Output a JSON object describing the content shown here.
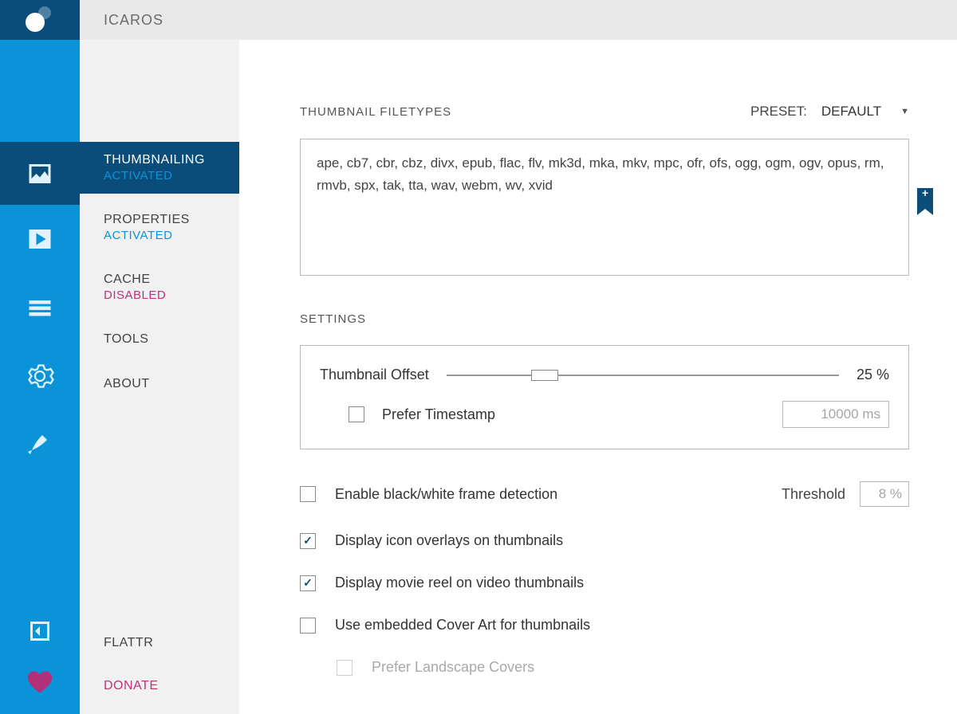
{
  "header": {
    "title": "ICAROS"
  },
  "sidebar": {
    "items": [
      {
        "label": "THUMBNAILING",
        "status": "ACTIVATED",
        "status_class": "activated"
      },
      {
        "label": "PROPERTIES",
        "status": "ACTIVATED",
        "status_class": "activated"
      },
      {
        "label": "CACHE",
        "status": "DISABLED",
        "status_class": "disabled"
      },
      {
        "label": "TOOLS"
      },
      {
        "label": "ABOUT"
      }
    ],
    "bottom": {
      "flattr": "FLATTR",
      "donate": "DONATE"
    }
  },
  "main": {
    "filetypes": {
      "title": "THUMBNAIL FILETYPES",
      "preset_label": "PRESET:",
      "preset_value": "DEFAULT",
      "list": "ape, cb7, cbr, cbz, divx, epub, flac, flv, mk3d, mka, mkv, mpc, ofr, ofs, ogg, ogm, ogv, opus, rm, rmvb, spx, tak, tta, wav, webm, wv, xvid"
    },
    "settings_title": "SETTINGS",
    "offset": {
      "label": "Thumbnail Offset",
      "value_text": "25 %",
      "percent": 25,
      "timestamp_label": "Prefer Timestamp",
      "timestamp_value": "10000 ms"
    },
    "options": {
      "o1": {
        "label": "Enable black/white frame detection",
        "checked": false,
        "threshold_label": "Threshold",
        "threshold_value": "8 %"
      },
      "o2": {
        "label": "Display icon overlays on thumbnails",
        "checked": true
      },
      "o3": {
        "label": "Display movie reel on video thumbnails",
        "checked": true
      },
      "o4": {
        "label": "Use embedded Cover Art for thumbnails",
        "checked": false
      },
      "o5": {
        "label": "Prefer Landscape Covers",
        "checked": false,
        "disabled": true
      }
    }
  }
}
